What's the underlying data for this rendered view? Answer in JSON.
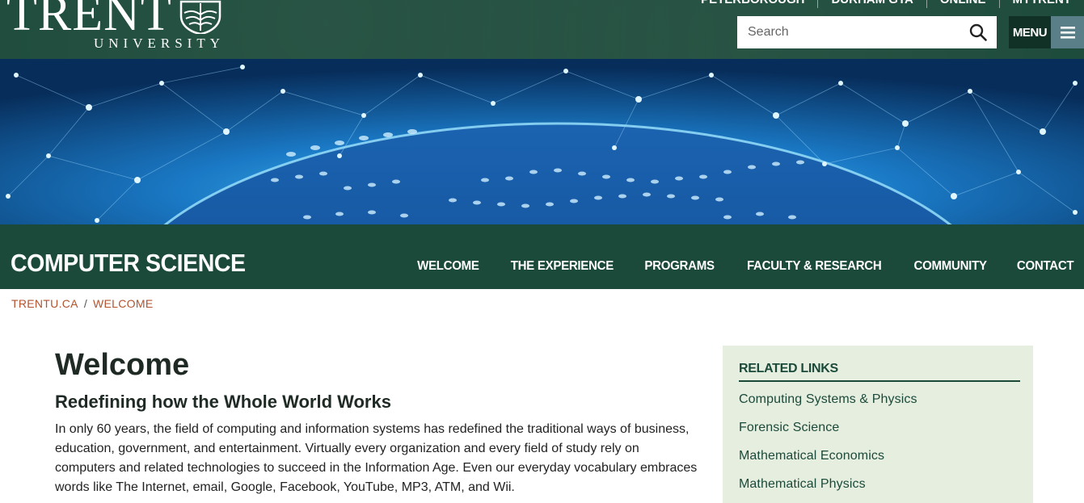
{
  "header": {
    "logo_word": "TRENT",
    "logo_sub": "UNIVERSITY",
    "top_links": [
      "PETERBOROUGH",
      "DURHAM GTA",
      "ONLINE",
      "MYTRENT"
    ],
    "search_placeholder": "Search",
    "menu_label": "MENU",
    "colors": {
      "brand_green": "#1c4a3a",
      "menu_dark": "#123126",
      "menu_icon_bg": "#5a7f88"
    }
  },
  "site": {
    "title": "COMPUTER SCIENCE",
    "nav": [
      "WELCOME",
      "THE EXPERIENCE",
      "PROGRAMS",
      "FACULTY & RESEARCH",
      "COMMUNITY",
      "CONTACT"
    ]
  },
  "breadcrumb": {
    "items": [
      "TRENTU.CA",
      "WELCOME"
    ],
    "separator": "/"
  },
  "main": {
    "title": "Welcome",
    "subtitle": "Redefining how the Whole World Works",
    "intro": "In only 60 years, the field of computing and information systems has redefined the traditional ways of business, education, government, and entertainment.  Virtually every organization and every field of study rely on computers and related technologies to succeed in the Information Age.  Even our everyday vocabulary embraces words like The Internet, email, Google, Facebook, YouTube, MP3, ATM, and Wii."
  },
  "related": {
    "heading": "RELATED LINKS",
    "links": [
      "Computing Systems & Physics",
      "Forensic Science",
      "Mathematical Economics",
      "Mathematical Physics"
    ]
  },
  "icons": {
    "search": "search-icon",
    "menu": "hamburger-icon",
    "crest": "crest-icon"
  }
}
